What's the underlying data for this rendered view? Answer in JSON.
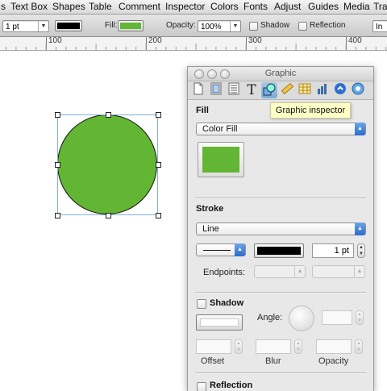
{
  "menubar": {
    "items": [
      "s",
      "Text Box",
      "Shapes",
      "Table",
      "Comment",
      "Inspector",
      "Colors",
      "Fonts",
      "Adjust",
      "Guides",
      "Media",
      "Tra"
    ]
  },
  "formatbar": {
    "line_width": "1 pt",
    "stroke_color": "#000000",
    "fill_label": "Fill:",
    "fill_color": "#63b633",
    "opacity_label": "Opacity:",
    "opacity_value": "100%",
    "shadow_label": "Shadow",
    "reflection_label": "Reflection",
    "extra_label": "In"
  },
  "ruler": {
    "labels": [
      "100",
      "200",
      "300",
      "400"
    ]
  },
  "canvas": {
    "shape": "circle",
    "fill_color": "#63b633",
    "stroke_color": "#111111"
  },
  "inspector": {
    "title": "Graphic",
    "active_tab": "graphic-inspector",
    "tooltip": "Graphic inspector",
    "fill": {
      "title": "Fill",
      "type": "Color Fill",
      "color": "#63b633"
    },
    "stroke": {
      "title": "Stroke",
      "type": "Line",
      "color": "#000000",
      "width": "1 pt",
      "endpoints_label": "Endpoints:"
    },
    "shadow": {
      "title": "Shadow",
      "angle_label": "Angle:",
      "offset_label": "Offset",
      "blur_label": "Blur",
      "opacity_label": "Opacity"
    },
    "reflection": {
      "title": "Reflection"
    }
  },
  "tab_icons": [
    "document-icon",
    "layout-icon",
    "wrap-icon",
    "text-icon",
    "graphic-icon",
    "metrics-icon",
    "table-icon",
    "chart-icon",
    "link-icon",
    "quicktime-icon"
  ]
}
